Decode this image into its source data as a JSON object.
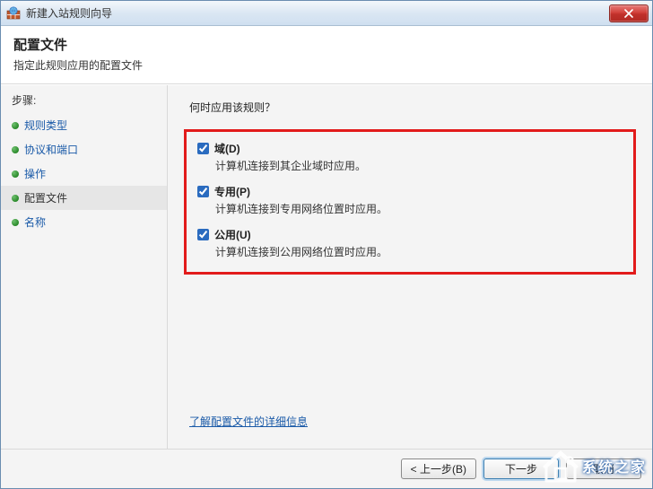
{
  "window": {
    "title": "新建入站规则向导"
  },
  "header": {
    "title": "配置文件",
    "subtitle": "指定此规则应用的配置文件"
  },
  "sidebar": {
    "heading": "步骤",
    "items": [
      {
        "label": "规则类型"
      },
      {
        "label": "协议和端口"
      },
      {
        "label": "操作"
      },
      {
        "label": "配置文件"
      },
      {
        "label": "名称"
      }
    ]
  },
  "main": {
    "question": "何时应用该规则？",
    "options": [
      {
        "label": "域(D)",
        "desc": "计算机连接到其企业域时应用。",
        "checked": true
      },
      {
        "label": "专用(P)",
        "desc": "计算机连接到专用网络位置时应用。",
        "checked": true
      },
      {
        "label": "公用(U)",
        "desc": "计算机连接到公用网络位置时应用。",
        "checked": true
      }
    ],
    "link": "了解配置文件的详细信息"
  },
  "footer": {
    "back": "< 上一步(B)",
    "next": "下一步",
    "cancel": "取消"
  },
  "watermark": {
    "text": "系统之家"
  }
}
